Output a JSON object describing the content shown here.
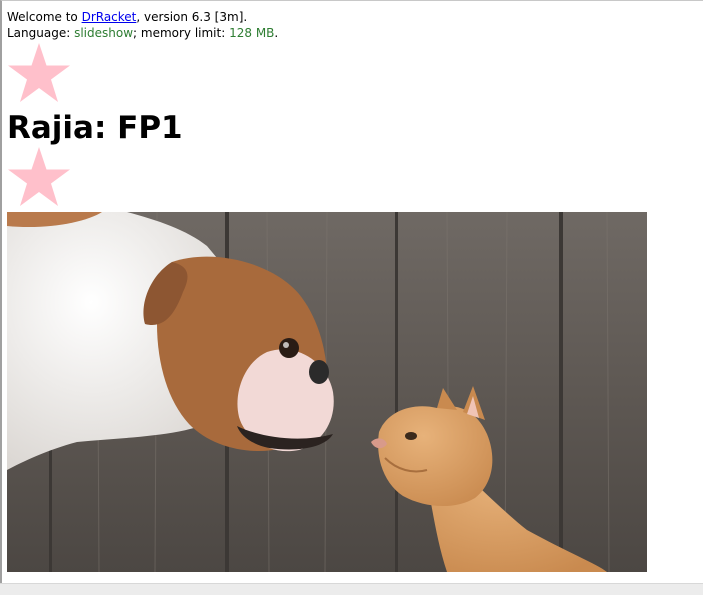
{
  "repl": {
    "welcome_prefix": "Welcome to ",
    "app_link": "DrRacket",
    "version_text": ", version 6.3 [3m].",
    "language_prefix": "Language: ",
    "language": "slideshow",
    "memory_prefix": "; memory limit: ",
    "memory_value": "128 MB",
    "memory_suffix": "."
  },
  "slide": {
    "title": "Rajia: FP1",
    "star_color": "#ffc0cb",
    "image_icon": "dog-and-cat-photo"
  }
}
